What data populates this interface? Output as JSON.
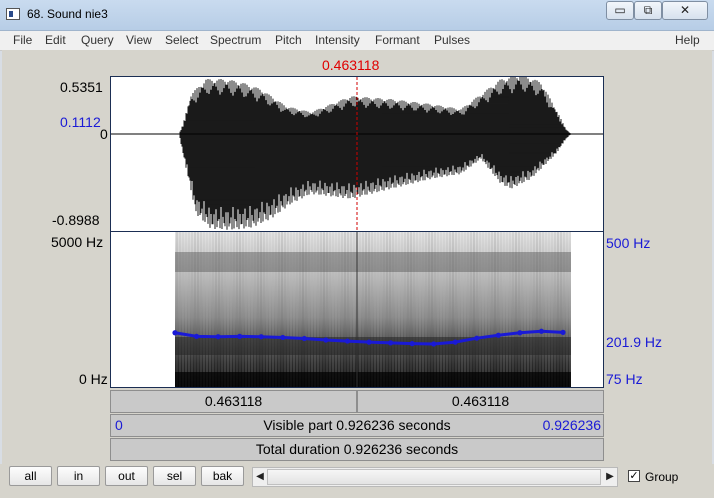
{
  "window": {
    "title": "68. Sound nie3",
    "minimize_glyph": "▭",
    "maximize_glyph": "⧉",
    "close_glyph": "✕",
    "icon": "window-app-icon"
  },
  "menu": [
    "File",
    "Edit",
    "Query",
    "View",
    "Select",
    "Spectrum",
    "Pitch",
    "Intensity",
    "Formant",
    "Pulses"
  ],
  "help_label": "Help",
  "cursor": {
    "time_label": "0.463118",
    "time_s": 0.463118
  },
  "waveform": {
    "max_label": "0.5351",
    "cursor_value_label": "0.1112",
    "zero_label": "0",
    "min_label": "-0.8988",
    "range": [
      -0.8988,
      0.5351
    ]
  },
  "spectrogram": {
    "top_freq_label": "5000 Hz",
    "bottom_freq_label": "0 Hz",
    "pitch_top_label": "500 Hz",
    "pitch_value_label": "201.9 Hz",
    "pitch_bottom_label": "75 Hz",
    "pitch_range_hz": [
      75,
      500
    ]
  },
  "bars": {
    "left_segment": "0.463118",
    "right_segment": "0.463118",
    "visible_start": "0",
    "visible_text": "Visible part 0.926236 seconds",
    "visible_end": "0.926236",
    "total_text": "Total duration 0.926236 seconds"
  },
  "toolbar": {
    "buttons": [
      "all",
      "in",
      "out",
      "sel",
      "bak"
    ],
    "group_label": "Group",
    "group_checked": true,
    "check_glyph": "✓",
    "scroll_left_glyph": "◀",
    "scroll_right_glyph": "▶"
  },
  "chart_data": {
    "type": "line",
    "pitch_contour": {
      "x": [
        0.0,
        0.05,
        0.1,
        0.15,
        0.2,
        0.25,
        0.3,
        0.35,
        0.4,
        0.45,
        0.5,
        0.55,
        0.6,
        0.65,
        0.7,
        0.75,
        0.8,
        0.85,
        0.9
      ],
      "y": [
        222,
        212,
        211,
        212,
        211,
        209,
        206,
        202,
        199,
        196,
        194,
        192,
        191,
        196,
        207,
        215,
        222,
        226,
        223
      ]
    }
  }
}
